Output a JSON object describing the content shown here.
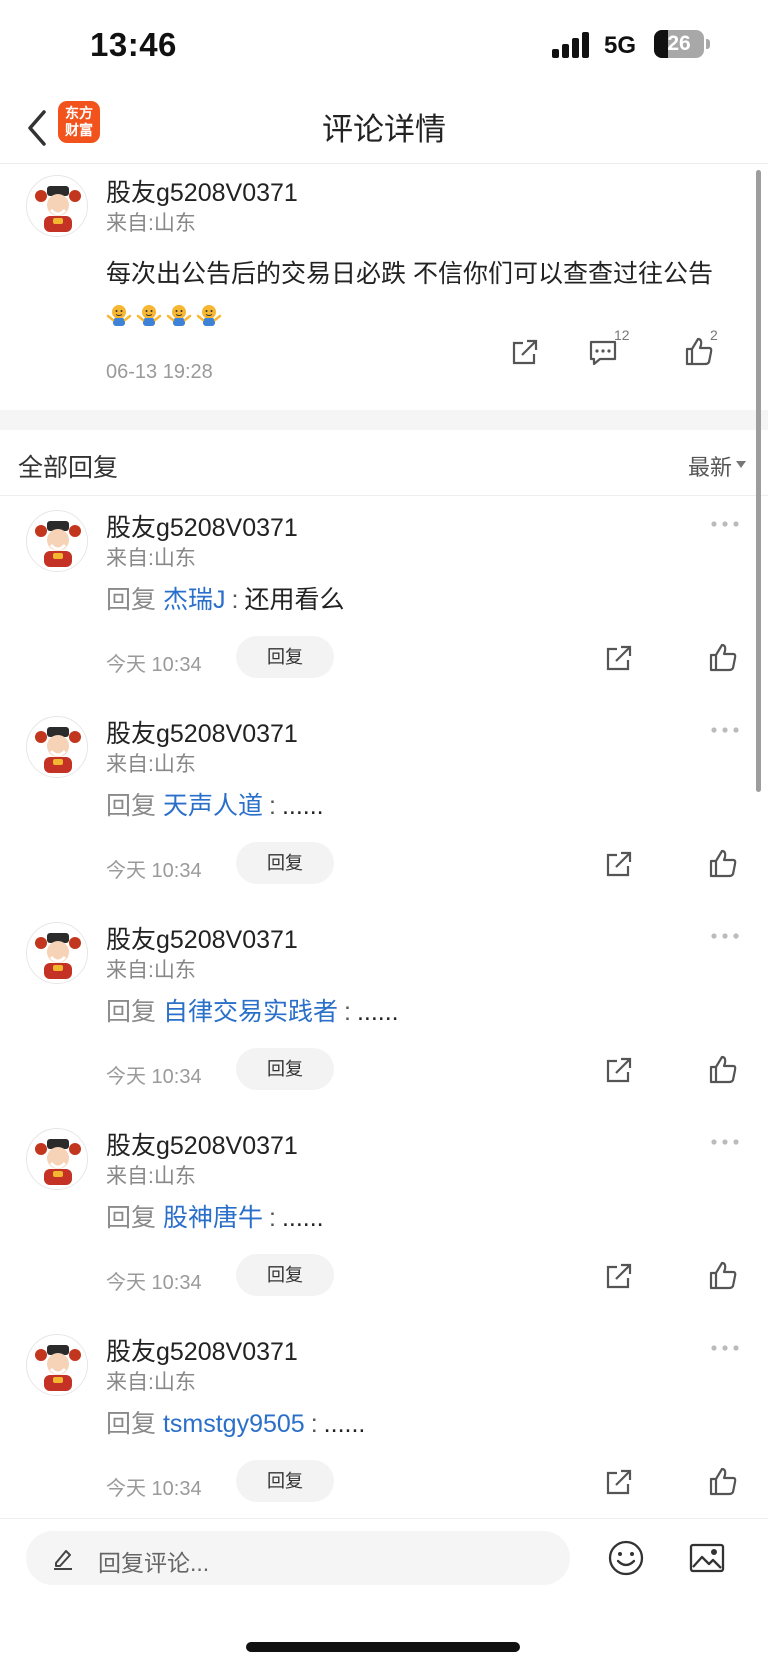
{
  "status_bar": {
    "time": "13:46",
    "network": "5G",
    "battery": "26"
  },
  "nav": {
    "title": "评论详情",
    "logo_line1": "东方",
    "logo_line2": "财富"
  },
  "main_comment": {
    "username": "股友g5208V0371",
    "location": "来自:山东",
    "text": "每次出公告后的交易日必跌 不信你们可以查查过往公告",
    "emoji_count": 4,
    "time": "06-13 19:28",
    "reply_count": "12",
    "like_count": "2"
  },
  "section": {
    "title": "全部回复",
    "sort_label": "最新"
  },
  "replies": [
    {
      "username": "股友g5208V0371",
      "location": "来自:山东",
      "prefix": "回复",
      "target": "杰瑞J",
      "colon": ":",
      "text": "还用看么",
      "time": "今天 10:34",
      "reply_button": "回复"
    },
    {
      "username": "股友g5208V0371",
      "location": "来自:山东",
      "prefix": "回复",
      "target": "天声人道",
      "colon": ":",
      "text": "......",
      "time": "今天 10:34",
      "reply_button": "回复"
    },
    {
      "username": "股友g5208V0371",
      "location": "来自:山东",
      "prefix": "回复",
      "target": "自律交易实践者",
      "colon": ":",
      "text": "......",
      "time": "今天 10:34",
      "reply_button": "回复"
    },
    {
      "username": "股友g5208V0371",
      "location": "来自:山东",
      "prefix": "回复",
      "target": "股神唐牛",
      "colon": ":",
      "text": "......",
      "time": "今天 10:34",
      "reply_button": "回复"
    },
    {
      "username": "股友g5208V0371",
      "location": "来自:山东",
      "prefix": "回复",
      "target": "tsmstgy9505",
      "colon": ":",
      "text": "......",
      "time": "今天 10:34",
      "reply_button": "回复"
    }
  ],
  "bottom_bar": {
    "placeholder": "回复评论..."
  },
  "colors": {
    "link": "#2a6fc9",
    "logo": "#f2531d",
    "muted": "#9a9a9a"
  }
}
